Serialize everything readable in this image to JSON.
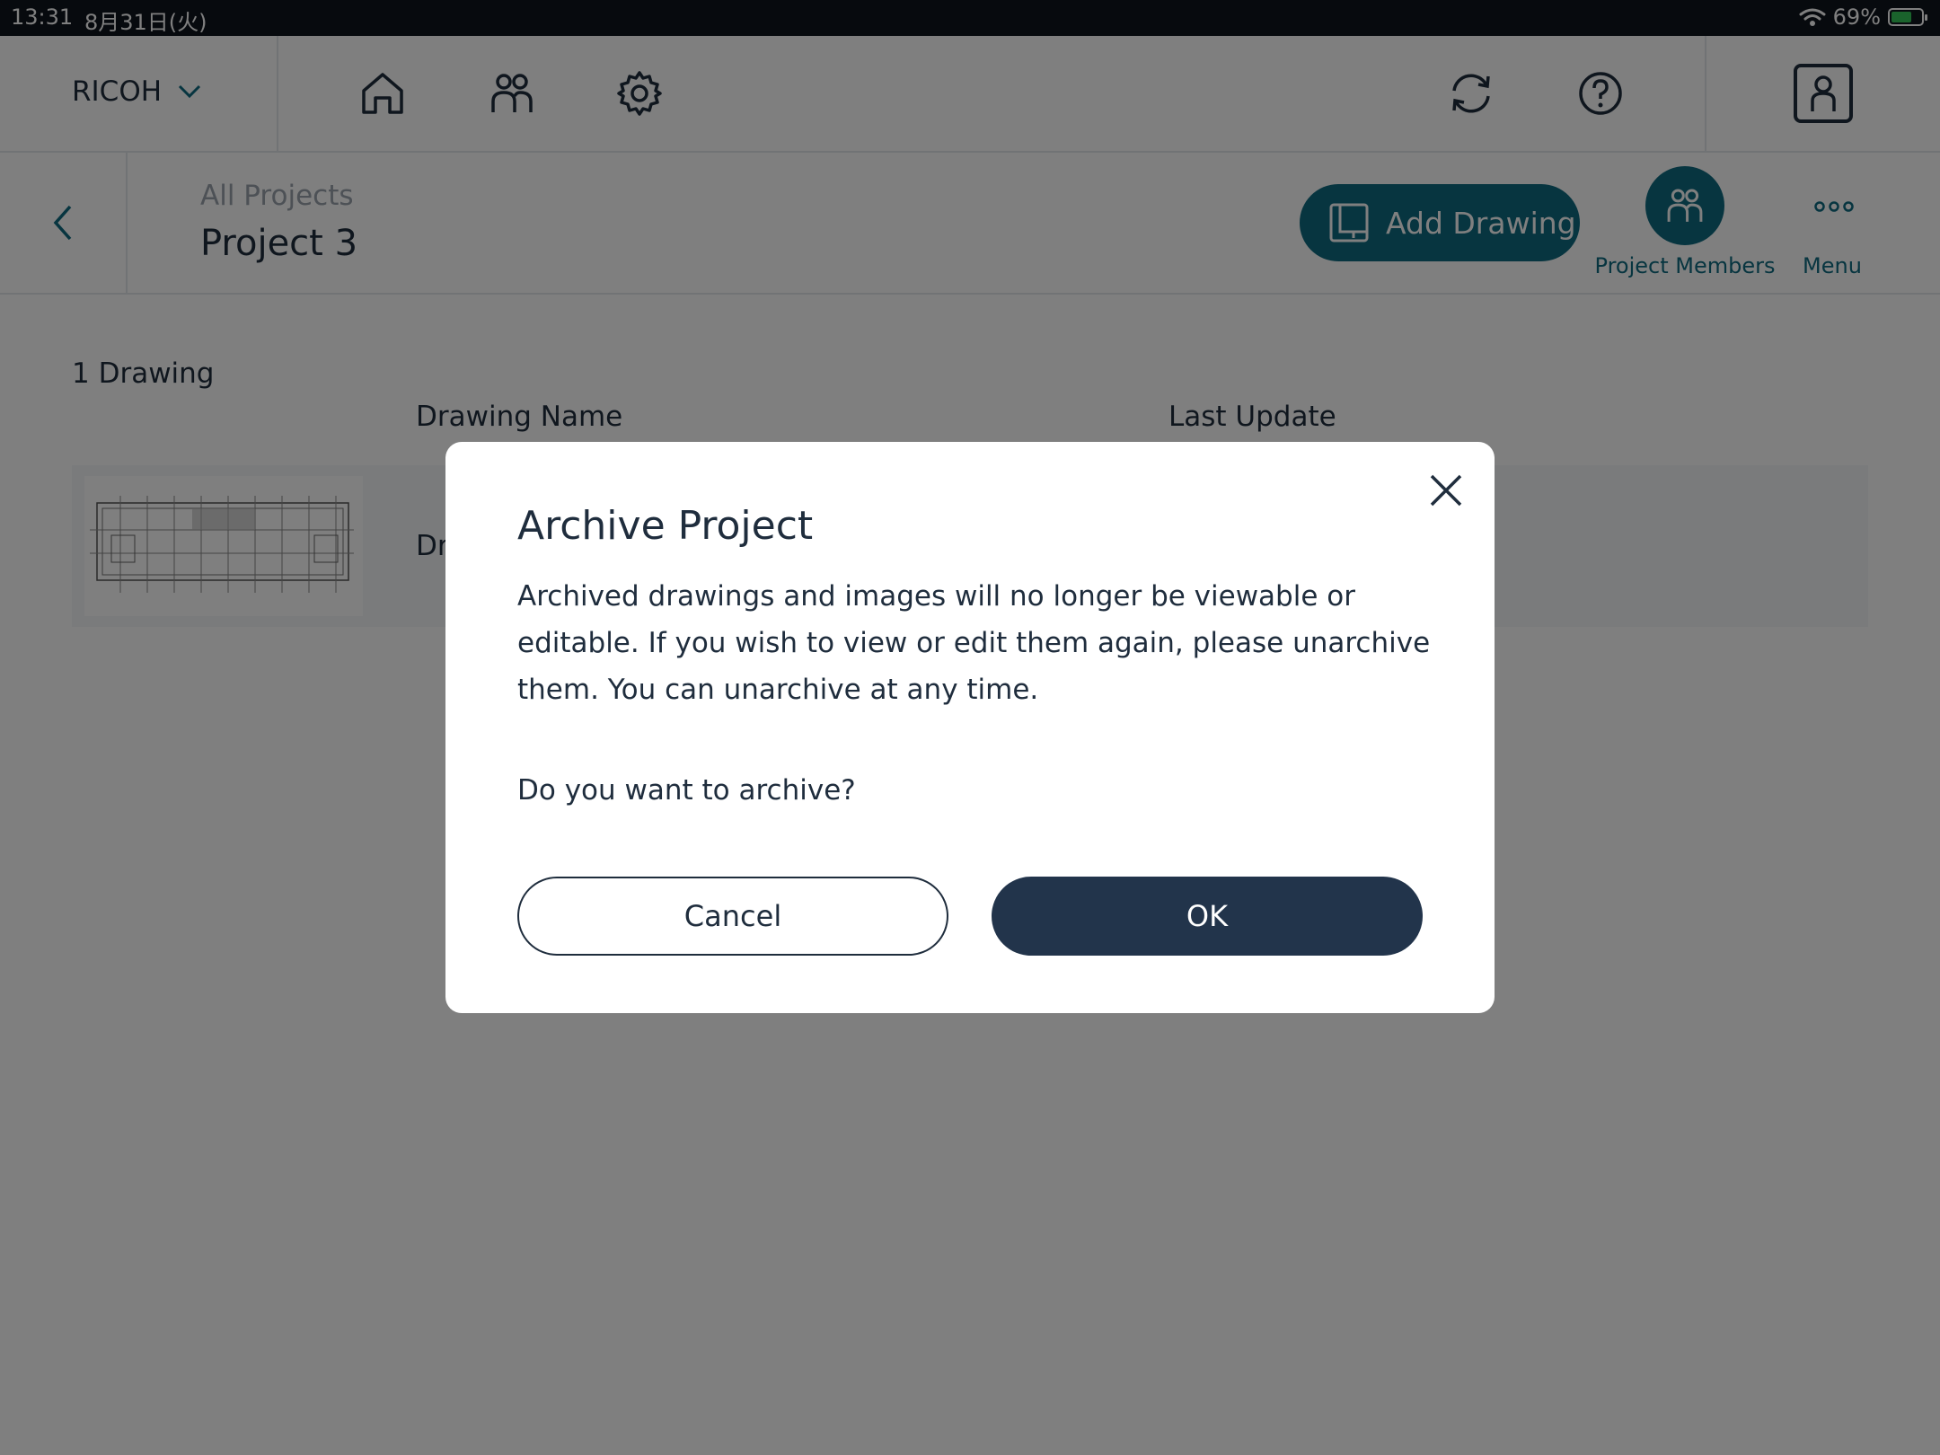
{
  "status_bar": {
    "time": "13:31",
    "date": "8月31日(火)",
    "battery": "69%",
    "battery_level": 0.69
  },
  "top_nav": {
    "brand": "RICOH",
    "icons": [
      "home-icon",
      "users-icon",
      "settings-icon",
      "sync-icon",
      "help-icon",
      "account-icon"
    ]
  },
  "sub_header": {
    "breadcrumb": "All Projects",
    "title": "Project 3",
    "add_drawing": "Add Drawing",
    "project_members": "Project Members",
    "menu": "Menu"
  },
  "content": {
    "drawing_count": "1 Drawing",
    "columns": [
      "Drawing Name",
      "Last Update"
    ],
    "rows": [
      {
        "name_visible": "Dr"
      }
    ]
  },
  "dialog": {
    "title": "Archive Project",
    "body": "Archived drawings and images will no longer be viewable or editable. If you wish to view or edit them again, please unarchive them. You can unarchive at any time.",
    "question": "Do you want to archive?",
    "cancel": "Cancel",
    "ok": "OK"
  },
  "colors": {
    "accent": "#0f6b80",
    "dark": "#22344b",
    "text": "#1f2d3d"
  }
}
